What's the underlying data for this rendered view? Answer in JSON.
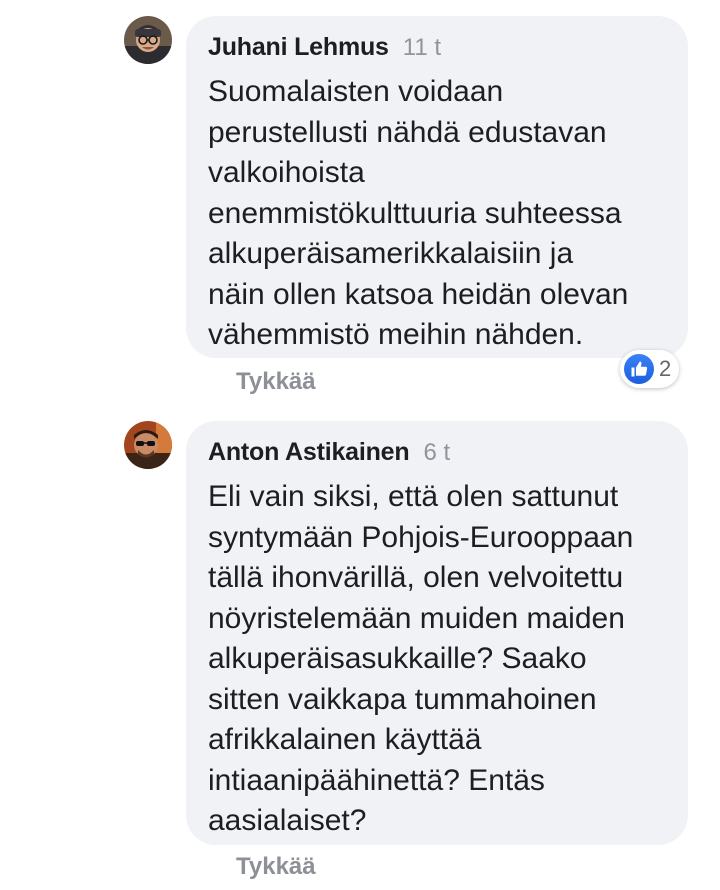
{
  "comments": [
    {
      "author": "Juhani Lehmus",
      "time": "11 t",
      "text": "Suomalaisten voidaan\nperustellusti nähdä edustavan\nvalkoihoista\nenemmistökulttuuria suhteessa\nalkuperäisamerikkalaisiin ja\nnäin ollen katsoa heidän olevan\nvähemmistö meihin nähden.",
      "like_label": "Tykkää",
      "reaction_count": "2",
      "reaction_icon": "like-icon",
      "avatar_icon": "profile-photo-glasses-beanie"
    },
    {
      "author": "Anton Astikainen",
      "time": "6 t",
      "text": "Eli vain siksi, että olen sattunut\nsyntymään Pohjois-Eurooppaan\ntällä ihonvärillä, olen velvoitettu\nnöyristelemään muiden maiden\nalkuperäisasukkaille? Saako\nsitten vaikkapa tummahoinen\nafrikkalainen käyttää\nintiaanipäähinettä? Entäs\naasialaiset?",
      "like_label": "Tykkää",
      "avatar_icon": "profile-photo-sunglasses"
    }
  ],
  "colors": {
    "bubble": "#f0f2f5",
    "text": "#1c1e21",
    "meta": "#90949c",
    "like_blue": "#1a5ee0"
  }
}
